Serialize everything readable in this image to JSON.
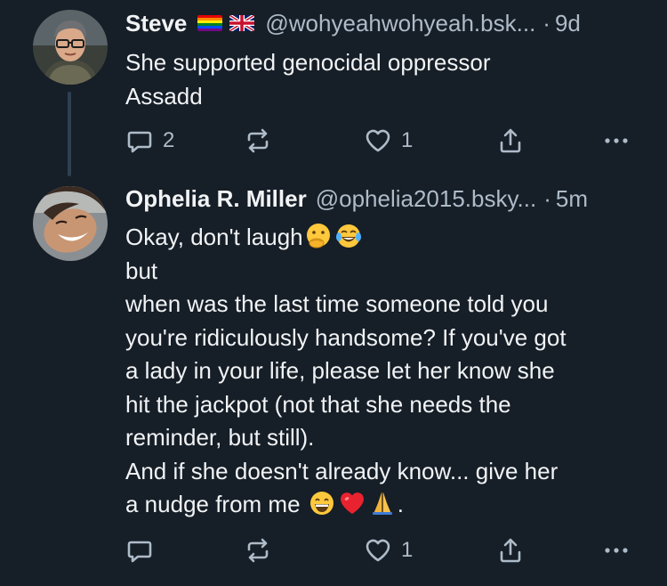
{
  "colors": {
    "background": "#161e27",
    "text_primary": "#f1f3f5",
    "text_secondary": "#aebbc9",
    "thread_line": "#2e4052"
  },
  "posts": [
    {
      "author_name": "Steve",
      "flags": [
        "rainbow-flag-icon",
        "union-jack-flag-icon"
      ],
      "handle": "@wohyeahwohyeah.bsk...",
      "separator": "·",
      "time": "9d",
      "text": "She supported genocidal oppressor\nAssadd",
      "reply_count": "2",
      "repost_count": "",
      "like_count": "1"
    },
    {
      "author_name": "Ophelia R. Miller",
      "handle": "@ophelia2015.bsky...",
      "separator": "·",
      "time": "5m",
      "text_line1": "Okay, don't laugh",
      "text_middle": "\nbut\nwhen was the last time someone told you\nyou're ridiculously handsome? If you've got\na lady in your life, please let her know she\nhit the jackpot (not that she needs the\nreminder, but still).\nAnd if she doesn't already know... give her\na nudge from me ",
      "text_end": ".",
      "emojis": [
        "face-with-hand-over-mouth-emoji",
        "tears-of-joy-emoji",
        "grinning-face-emoji",
        "red-heart-emoji",
        "folded-hands-emoji"
      ],
      "reply_count": "",
      "repost_count": "",
      "like_count": "1"
    }
  ]
}
